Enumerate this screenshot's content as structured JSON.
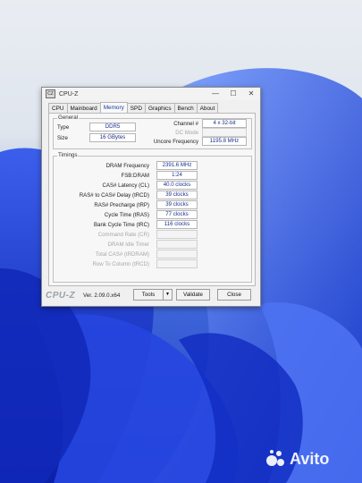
{
  "window": {
    "title": "CPU-Z",
    "app_icon_text": "CZ",
    "controls": [
      "—",
      "☐",
      "✕"
    ]
  },
  "tabs": [
    {
      "label": "CPU",
      "active": false
    },
    {
      "label": "Mainboard",
      "active": false
    },
    {
      "label": "Memory",
      "active": true
    },
    {
      "label": "SPD",
      "active": false
    },
    {
      "label": "Graphics",
      "active": false
    },
    {
      "label": "Bench",
      "active": false
    },
    {
      "label": "About",
      "active": false
    }
  ],
  "general": {
    "label": "General",
    "type_label": "Type",
    "type_value": "DDR5",
    "size_label": "Size",
    "size_value": "16 GBytes",
    "channel_label": "Channel #",
    "channel_value": "4 x 32-bit",
    "dc_mode_label": "DC Mode",
    "dc_mode_value": "",
    "uncore_label": "Uncore Frequency",
    "uncore_value": "1195.8 MHz"
  },
  "timings": {
    "label": "Timings",
    "rows": [
      {
        "label": "DRAM Frequency",
        "value": "2391.6 MHz",
        "enabled": true
      },
      {
        "label": "FSB:DRAM",
        "value": "1:24",
        "enabled": true
      },
      {
        "label": "CAS# Latency (CL)",
        "value": "40.0 clocks",
        "enabled": true
      },
      {
        "label": "RAS# to CAS# Delay (tRCD)",
        "value": "39 clocks",
        "enabled": true
      },
      {
        "label": "RAS# Precharge (tRP)",
        "value": "39 clocks",
        "enabled": true
      },
      {
        "label": "Cycle Time (tRAS)",
        "value": "77 clocks",
        "enabled": true
      },
      {
        "label": "Bank Cycle Time (tRC)",
        "value": "116 clocks",
        "enabled": true
      },
      {
        "label": "Command Rate (CR)",
        "value": "",
        "enabled": false
      },
      {
        "label": "DRAM Idle Timer",
        "value": "",
        "enabled": false
      },
      {
        "label": "Total CAS# (tRDRAM)",
        "value": "",
        "enabled": false
      },
      {
        "label": "Row To Column (tRCD)",
        "value": "",
        "enabled": false
      }
    ]
  },
  "footer": {
    "logo": "CPU-Z",
    "version": "Ver. 2.09.0.x64",
    "tools_label": "Tools",
    "tools_arrow": "▼",
    "validate_label": "Validate",
    "close_label": "Close"
  },
  "watermark": {
    "text": "Avito"
  }
}
